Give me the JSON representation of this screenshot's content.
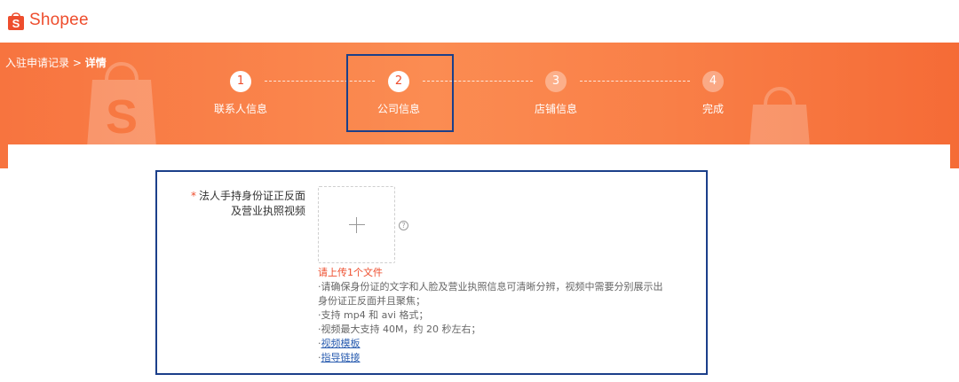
{
  "brand": {
    "name": "Shopee",
    "accent": "#ee4d2d"
  },
  "breadcrumb": {
    "parent": "入驻申请记录",
    "separator": ">",
    "current": "详情"
  },
  "steps": [
    {
      "number": "1",
      "label": "联系人信息",
      "state": "done"
    },
    {
      "number": "2",
      "label": "公司信息",
      "state": "active"
    },
    {
      "number": "3",
      "label": "店铺信息",
      "state": "pending"
    },
    {
      "number": "4",
      "label": "完成",
      "state": "pending"
    }
  ],
  "form": {
    "required_mark": "*",
    "label_line1": "法人手持身份证正反面",
    "label_line2": "及营业执照视频",
    "help_icon": "?",
    "error": "请上传1个文件",
    "tips": [
      "·请确保身份证的文字和人脸及营业执照信息可清晰分辨，视频中需要分别展示出",
      "身份证正反面并且聚焦；",
      "·支持 mp4 和 avi 格式；",
      "·视频最大支持 40M，约 20 秒左右；"
    ],
    "link_bullet": "·",
    "links": [
      "视频模板",
      "指导链接"
    ]
  }
}
